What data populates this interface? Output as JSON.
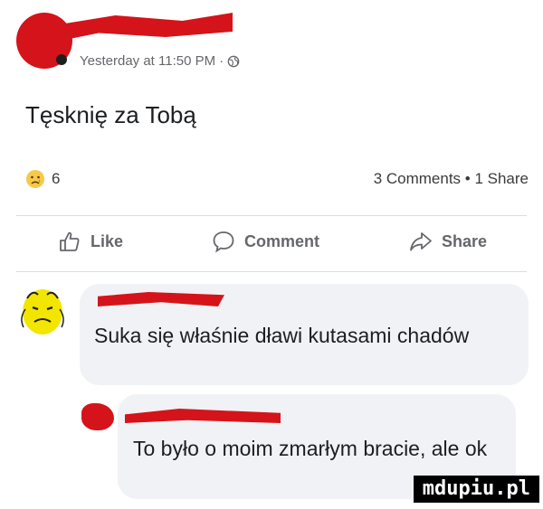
{
  "post": {
    "timestamp": "Yesterday at 11:50 PM",
    "separator": "·",
    "privacy_icon": "globe-icon",
    "text": "Tęsknię za Tobą",
    "reaction_icon": "sad-emoji-icon",
    "reaction_count": "6",
    "stats": "3 Comments • 1 Share"
  },
  "actions": {
    "like": "Like",
    "comment": "Comment",
    "share": "Share"
  },
  "comments": [
    {
      "text": "Suka się właśnie dławi kutasami chadów"
    },
    {
      "text": "To było o moim zmarłym bracie, ale ok"
    }
  ],
  "watermark": "mdupiu.pl",
  "colors": {
    "redaction": "#d4141a",
    "bubble": "#f0f2f5",
    "meta_text": "#65676b"
  }
}
